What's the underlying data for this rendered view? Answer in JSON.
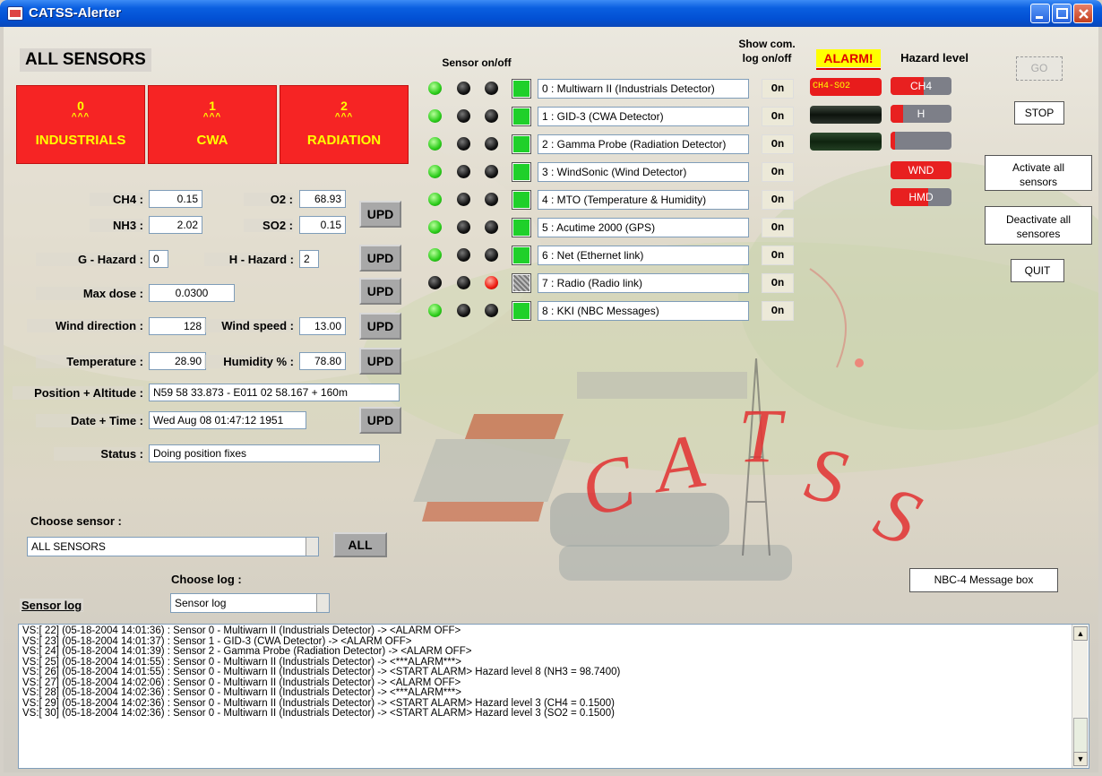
{
  "window": {
    "title": "CATSS-Alerter"
  },
  "left": {
    "heading": "ALL SENSORS",
    "categories": [
      {
        "count": "0",
        "carets": "^^^",
        "label": "INDUSTRIALS"
      },
      {
        "count": "1",
        "carets": "^^^",
        "label": "CWA"
      },
      {
        "count": "2",
        "carets": "^^^",
        "label": "RADIATION"
      }
    ],
    "readings": {
      "ch4_label": "CH4 :",
      "ch4": "0.15",
      "o2_label": "O2 :",
      "o2": "68.93",
      "nh3_label": "NH3 :",
      "nh3": "2.02",
      "so2_label": "SO2 :",
      "so2": "0.15",
      "ghazard_label": "G - Hazard :",
      "ghazard": "0",
      "hhazard_label": "H - Hazard :",
      "hhazard": "2",
      "maxdose_label": "Max dose :",
      "maxdose": "0.0300",
      "winddir_label": "Wind direction :",
      "winddir": "128",
      "windspeed_label": "Wind speed :",
      "windspeed": "13.00",
      "temp_label": "Temperature :",
      "temp": "28.90",
      "humidity_label": "Humidity % :",
      "humidity": "78.80",
      "position_label": "Position + Altitude :",
      "position": "N59 58 33.873 - E011 02 58.167 + 160m",
      "datetime_label": "Date + Time :",
      "datetime": "Wed Aug 08 01:47:12 1951",
      "status_label": "Status :",
      "status": "Doing position fixes"
    },
    "upd_label": "UPD"
  },
  "sensors": {
    "onoff_header": "Sensor on/off",
    "comlog_header_1": "Show com.",
    "comlog_header_2": "log on/off",
    "on_label": "On",
    "items": [
      {
        "name": "0 : Multiwarn II (Industrials Detector)",
        "led1": "g",
        "led2": "k",
        "led3": "k",
        "state": "on"
      },
      {
        "name": "1 : GID-3 (CWA Detector)",
        "led1": "g",
        "led2": "k",
        "led3": "k",
        "state": "on"
      },
      {
        "name": "2 : Gamma Probe (Radiation Detector)",
        "led1": "g",
        "led2": "k",
        "led3": "k",
        "state": "on"
      },
      {
        "name": "3 : WindSonic (Wind Detector)",
        "led1": "g",
        "led2": "k",
        "led3": "k",
        "state": "on"
      },
      {
        "name": "4 : MTO (Temperature & Humidity)",
        "led1": "g",
        "led2": "k",
        "led3": "k",
        "state": "on"
      },
      {
        "name": "5 : Acutime 2000 (GPS)",
        "led1": "g",
        "led2": "k",
        "led3": "k",
        "state": "on"
      },
      {
        "name": "6 : Net (Ethernet link)",
        "led1": "g",
        "led2": "k",
        "led3": "k",
        "state": "on"
      },
      {
        "name": "7 : Radio (Radio link)",
        "led1": "k",
        "led2": "k",
        "led3": "r",
        "state": "off"
      },
      {
        "name": "8 : KKI (NBC Messages)",
        "led1": "g",
        "led2": "k",
        "led3": "k",
        "state": "on"
      }
    ]
  },
  "alarm": {
    "label": "ALARM!",
    "hazard_header": "Hazard level",
    "bar_text": "CH4-SO2",
    "hazard_bars": [
      {
        "label": "CH4",
        "level": 0.55
      },
      {
        "label": "H",
        "level": 0.2
      },
      {
        "label": "",
        "level": 0.08
      },
      {
        "label": "WND",
        "level": 1.0
      },
      {
        "label": "HMD",
        "level": 0.62
      }
    ]
  },
  "controls": {
    "go": "GO",
    "stop": "STOP",
    "activate_all_1": "Activate all",
    "activate_all_2": "sensors",
    "deactivate_all_1": "Deactivate all",
    "deactivate_all_2": "sensores",
    "quit": "QUIT",
    "nbc_box": "NBC-4 Message box"
  },
  "bottom": {
    "choose_sensor_label": "Choose sensor :",
    "choose_sensor_value": "ALL SENSORS",
    "all_button": "ALL",
    "choose_log_label": "Choose log :",
    "choose_log_value": "Sensor log",
    "log_title": "Sensor log",
    "log_lines": [
      "VS:[  22] (05-18-2004 14:01:36) : Sensor 0 - Multiwarn II (Industrials Detector) -> <ALARM OFF>",
      "VS:[  23] (05-18-2004 14:01:37) : Sensor 1 - GID-3 (CWA Detector) -> <ALARM OFF>",
      "VS:[  24] (05-18-2004 14:01:39) : Sensor 2 - Gamma Probe (Radiation Detector) -> <ALARM OFF>",
      "VS:[  25] (05-18-2004 14:01:55) : Sensor 0 - Multiwarn II (Industrials Detector) -> <***ALARM***>",
      "VS:[  26] (05-18-2004 14:01:55) : Sensor 0 - Multiwarn II (Industrials Detector) -> <START ALARM> Hazard level 8 (NH3 = 98.7400)",
      "VS:[  27] (05-18-2004 14:02:06) : Sensor 0 - Multiwarn II (Industrials Detector) -> <ALARM OFF>",
      "VS:[  28] (05-18-2004 14:02:36) : Sensor 0 - Multiwarn II (Industrials Detector) -> <***ALARM***>",
      "VS:[  29] (05-18-2004 14:02:36) : Sensor 0 - Multiwarn II (Industrials Detector) -> <START ALARM> Hazard level 3 (CH4 = 0.1500)",
      "VS:[  30] (05-18-2004 14:02:36) : Sensor 0 - Multiwarn II (Industrials Detector) -> <START ALARM> Hazard level 3 (SO2 = 0.1500)"
    ]
  },
  "watermark": "CATSS"
}
